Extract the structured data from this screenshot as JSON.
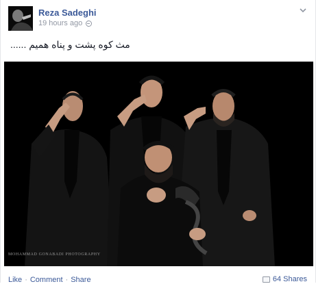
{
  "post": {
    "author": "Reza Sadeghi",
    "timestamp": "19 hours ago",
    "privacy_icon": "globe-icon",
    "menu_icon": "chevron-down-icon",
    "message": "مث کوه پشت و پناه همیم ......",
    "photo": {
      "watermark": "Mohammad Gonabadi Photography"
    },
    "actions": {
      "like": "Like",
      "comment": "Comment",
      "share": "Share",
      "separator": "·"
    },
    "shares_count": "64 Shares"
  },
  "colors": {
    "link": "#3b5998",
    "meta": "#9197a3",
    "photo_background": "#000000"
  }
}
